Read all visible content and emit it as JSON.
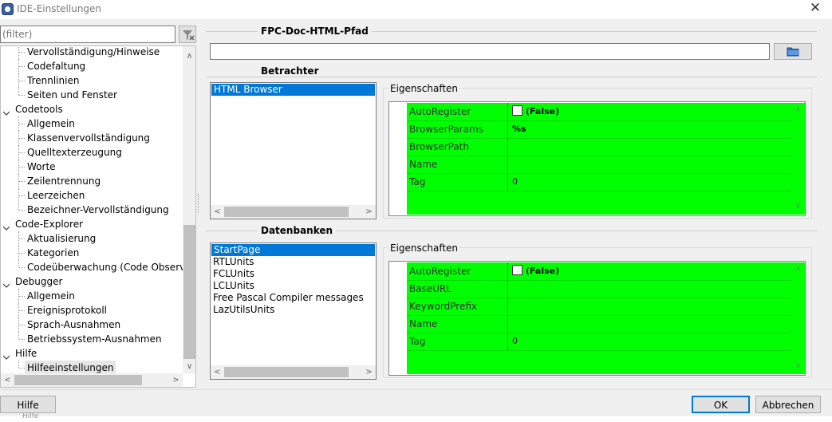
{
  "window": {
    "title": "IDE-Einstellungen",
    "close_glyph": "✕",
    "app_icon": "lazarus-icon"
  },
  "filter": {
    "placeholder": "(filter)",
    "button_icon": "filter-clear-icon"
  },
  "tree": {
    "items": [
      {
        "label": "Vervollständigung/Hinweise",
        "level": 1
      },
      {
        "label": "Codefaltung",
        "level": 1
      },
      {
        "label": "Trennlinien",
        "level": 1
      },
      {
        "label": "Seiten und Fenster",
        "level": 1,
        "last": true
      },
      {
        "label": "Codetools",
        "level": 0
      },
      {
        "label": "Allgemein",
        "level": 1
      },
      {
        "label": "Klassenvervollständigung",
        "level": 1
      },
      {
        "label": "Quelltexterzeugung",
        "level": 1
      },
      {
        "label": "Worte",
        "level": 1
      },
      {
        "label": "Zeilentrennung",
        "level": 1
      },
      {
        "label": "Leerzeichen",
        "level": 1
      },
      {
        "label": "Bezeichner-Vervollständigung",
        "level": 1,
        "last": true
      },
      {
        "label": "Code-Explorer",
        "level": 0
      },
      {
        "label": "Aktualisierung",
        "level": 1
      },
      {
        "label": "Kategorien",
        "level": 1
      },
      {
        "label": "Codeüberwachung (Code Observer)",
        "level": 1,
        "last": true
      },
      {
        "label": "Debugger",
        "level": 0
      },
      {
        "label": "Allgemein",
        "level": 1
      },
      {
        "label": "Ereignisprotokoll",
        "level": 1
      },
      {
        "label": "Sprach-Ausnahmen",
        "level": 1
      },
      {
        "label": "Betriebssystem-Ausnahmen",
        "level": 1,
        "last": true
      },
      {
        "label": "Hilfe",
        "level": 0
      },
      {
        "label": "Hilfeeinstellungen",
        "level": 1,
        "last": true,
        "selected": true
      }
    ]
  },
  "sections": {
    "path_title": "FPC-Doc-HTML-Pfad",
    "path_value": "",
    "viewer_title": "Betrachter",
    "db_title": "Datenbanken"
  },
  "viewers": {
    "items": [
      "HTML Browser"
    ],
    "properties_title": "Eigenschaften",
    "props": [
      {
        "name": "AutoRegister",
        "value": "(False)",
        "checkbox": true,
        "bold": true
      },
      {
        "name": "BrowserParams",
        "value": "%s",
        "bold": true
      },
      {
        "name": "BrowserPath",
        "value": ""
      },
      {
        "name": "Name",
        "value": ""
      },
      {
        "name": "Tag",
        "value": "0"
      }
    ]
  },
  "databases": {
    "items": [
      "StartPage",
      "RTLUnits",
      "FCLUnits",
      "LCLUnits",
      "Free Pascal Compiler messages",
      "LazUtilsUnits"
    ],
    "properties_title": "Eigenschaften",
    "props": [
      {
        "name": "AutoRegister",
        "value": "(False)",
        "checkbox": true,
        "bold": true
      },
      {
        "name": "BaseURL",
        "value": ""
      },
      {
        "name": "KeywordPrefix",
        "value": ""
      },
      {
        "name": "Name",
        "value": ""
      },
      {
        "name": "Tag",
        "value": "0"
      }
    ]
  },
  "buttons": {
    "help": "Hilfe",
    "ok": "OK",
    "cancel": "Abbrechen"
  },
  "background_text": "Hilfe",
  "colors": {
    "selection": "#0078d7",
    "grid_background": "#00ff00"
  }
}
